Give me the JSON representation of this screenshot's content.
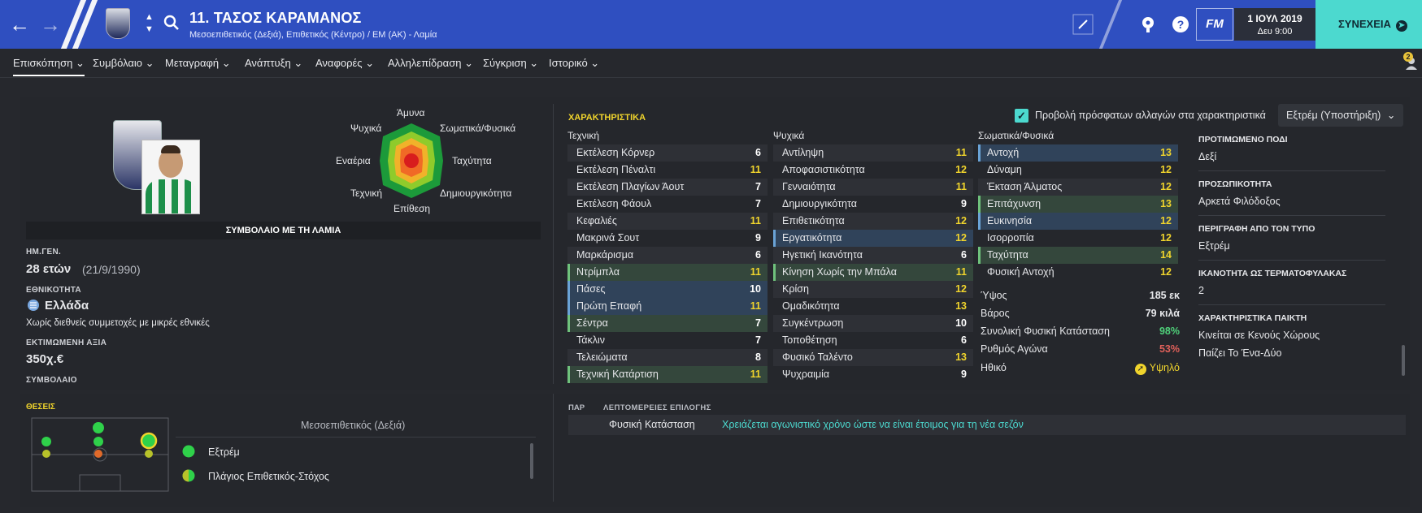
{
  "header": {
    "player_title": "11. ΤΑΣΟΣ ΚΑΡΑΜΑΝΟΣ",
    "player_subtitle": "Μεσοεπιθετικός (Δεξιά), Επιθετικός (Κέντρο) / ΕΜ (ΑΚ) - Λαμία",
    "fm_label": "FM",
    "date": "1 ΙΟΥΛ 2019",
    "day_time": "Δευ 9:00",
    "continue_label": "ΣΥΝΕΧΕΙΑ",
    "notification_count": "2"
  },
  "tabs": [
    "Επισκόπηση",
    "Συμβόλαιο",
    "Μεταγραφή",
    "Ανάπτυξη",
    "Αναφορές",
    "Αλληλεπίδραση",
    "Σύγκριση",
    "Ιστορικό"
  ],
  "radar": {
    "labels": {
      "top": "Άμυνα",
      "top_right": "Σωματικά/Φυσικά",
      "right": "Ταχύτητα",
      "bottom_right": "Δημιουργικότητα",
      "bottom": "Επίθεση",
      "bottom_left": "Τεχνική",
      "left": "Εναέρια",
      "top_left": "Ψυχικά"
    }
  },
  "contract_banner": "ΣΥΜΒΟΛΑΙΟ ΜΕ ΤΗ ΛΑΜΙΑ",
  "bio": {
    "dob_label": "ΗΜ.ΓΕΝ.",
    "age": "28 ετών",
    "dob": "(21/9/1990)",
    "nationality_label": "ΕΘΝΙΚΟΤΗΤΑ",
    "nationality": "Ελλάδα",
    "caps_note": "Χωρίς διεθνείς συμμετοχές με μικρές εθνικές",
    "value_label": "ΕΚΤΙΜΩΜΕΝΗ ΑΞΙΑ",
    "value": "350χ.€",
    "contract_label": "ΣΥΜΒΟΛΑΙΟ"
  },
  "attributes": {
    "section_title": "ΧΑΡΑΚΤΗΡΙΣΤΙΚΑ",
    "recent_changes_label": "Προβολή πρόσφατων αλλαγών στα χαρακτηριστικά",
    "role_select": "Εξτρέμ (Υποστήριξη)",
    "technical": {
      "title": "Τεχνική",
      "rows": [
        {
          "name": "Εκτέλεση Κόρνερ",
          "value": "6",
          "hl": ""
        },
        {
          "name": "Εκτέλεση Πέναλτι",
          "value": "11",
          "hl": ""
        },
        {
          "name": "Εκτέλεση Πλαγίων Άουτ",
          "value": "7",
          "hl": ""
        },
        {
          "name": "Εκτέλεση Φάουλ",
          "value": "7",
          "hl": ""
        },
        {
          "name": "Κεφαλιές",
          "value": "11",
          "hl": ""
        },
        {
          "name": "Μακρινά Σουτ",
          "value": "9",
          "hl": ""
        },
        {
          "name": "Μαρκάρισμα",
          "value": "6",
          "hl": ""
        },
        {
          "name": "Ντρίμπλα",
          "value": "11",
          "hl": "g"
        },
        {
          "name": "Πάσες",
          "value": "10",
          "hl": "b"
        },
        {
          "name": "Πρώτη Επαφή",
          "value": "11",
          "hl": "b"
        },
        {
          "name": "Σέντρα",
          "value": "7",
          "hl": "g"
        },
        {
          "name": "Τάκλιν",
          "value": "7",
          "hl": ""
        },
        {
          "name": "Τελειώματα",
          "value": "8",
          "hl": ""
        },
        {
          "name": "Τεχνική Κατάρτιση",
          "value": "11",
          "hl": "g"
        }
      ]
    },
    "mental": {
      "title": "Ψυχικά",
      "rows": [
        {
          "name": "Αντίληψη",
          "value": "11",
          "hl": ""
        },
        {
          "name": "Αποφασιστικότητα",
          "value": "12",
          "hl": ""
        },
        {
          "name": "Γενναιότητα",
          "value": "11",
          "hl": ""
        },
        {
          "name": "Δημιουργικότητα",
          "value": "9",
          "hl": ""
        },
        {
          "name": "Επιθετικότητα",
          "value": "12",
          "hl": ""
        },
        {
          "name": "Εργατικότητα",
          "value": "12",
          "hl": "b"
        },
        {
          "name": "Ηγετική Ικανότητα",
          "value": "6",
          "hl": ""
        },
        {
          "name": "Κίνηση Χωρίς την Μπάλα",
          "value": "11",
          "hl": "g"
        },
        {
          "name": "Κρίση",
          "value": "12",
          "hl": ""
        },
        {
          "name": "Ομαδικότητα",
          "value": "13",
          "hl": ""
        },
        {
          "name": "Συγκέντρωση",
          "value": "10",
          "hl": ""
        },
        {
          "name": "Τοποθέτηση",
          "value": "6",
          "hl": ""
        },
        {
          "name": "Φυσικό Ταλέντο",
          "value": "13",
          "hl": ""
        },
        {
          "name": "Ψυχραιμία",
          "value": "9",
          "hl": ""
        }
      ]
    },
    "physical": {
      "title": "Σωματικά/Φυσικά",
      "rows": [
        {
          "name": "Αντοχή",
          "value": "13",
          "hl": "b"
        },
        {
          "name": "Δύναμη",
          "value": "12",
          "hl": ""
        },
        {
          "name": "Έκταση Άλματος",
          "value": "12",
          "hl": ""
        },
        {
          "name": "Επιτάχυνση",
          "value": "13",
          "hl": "g"
        },
        {
          "name": "Ευκινησία",
          "value": "12",
          "hl": "b"
        },
        {
          "name": "Ισορροπία",
          "value": "12",
          "hl": ""
        },
        {
          "name": "Ταχύτητα",
          "value": "14",
          "hl": "g"
        },
        {
          "name": "Φυσική Αντοχή",
          "value": "12",
          "hl": ""
        }
      ]
    },
    "physical_stats": [
      {
        "name": "Ύψος",
        "value": "185 εκ",
        "color": "#ffffff"
      },
      {
        "name": "Βάρος",
        "value": "79 κιλά",
        "color": "#ffffff"
      },
      {
        "name": "Συνολική Φυσική Κατάσταση",
        "value": "98%",
        "color": "#4fd17a"
      },
      {
        "name": "Ρυθμός Αγώνα",
        "value": "53%",
        "color": "#e0605a"
      },
      {
        "name": "Ηθικό",
        "value": "Υψηλό",
        "color": "#f0d42c"
      }
    ]
  },
  "right_info": [
    {
      "title": "ΠΡΟΤΙΜΩΜΕΝΟ ΠΟΔΙ",
      "value": "Δεξί"
    },
    {
      "title": "ΠΡΟΣΩΠΙΚΟΤΗΤΑ",
      "value": "Αρκετά Φιλόδοξος"
    },
    {
      "title": "ΠΕΡΙΓΡΑΦΗ ΑΠΟ ΤΟΝ ΤΥΠΟ",
      "value": "Εξτρέμ"
    },
    {
      "title": "ΙΚΑΝΟΤΗΤΑ ΩΣ ΤΕΡΜΑΤΟΦΥΛΑΚΑΣ",
      "value": "2"
    },
    {
      "title": "ΧΑΡΑΚΤΗΡΙΣΤΙΚΑ ΠΑΙΚΤΗ",
      "value": "Κινείται σε Κενούς Χώρους",
      "value2": "Παίζει Το Ένα-Δύο"
    }
  ],
  "positions": {
    "title": "ΘΕΣΕΙΣ",
    "selected_position": "Μεσοεπιθετικός (Δεξιά)",
    "roles": [
      "Εξτρέμ",
      "Πλάγιος Επιθετικός-Στόχος"
    ]
  },
  "selection": {
    "col1": "ΠΑΡ",
    "col2": "ΛΕΠΤΟΜΕΡΕΙΕΣ ΕΠΙΛΟΓΗΣ",
    "item": "Φυσική Κατάσταση",
    "detail": "Χρειάζεται αγωνιστικό χρόνο ώστε να είναι έτοιμος για τη νέα σεζόν"
  }
}
